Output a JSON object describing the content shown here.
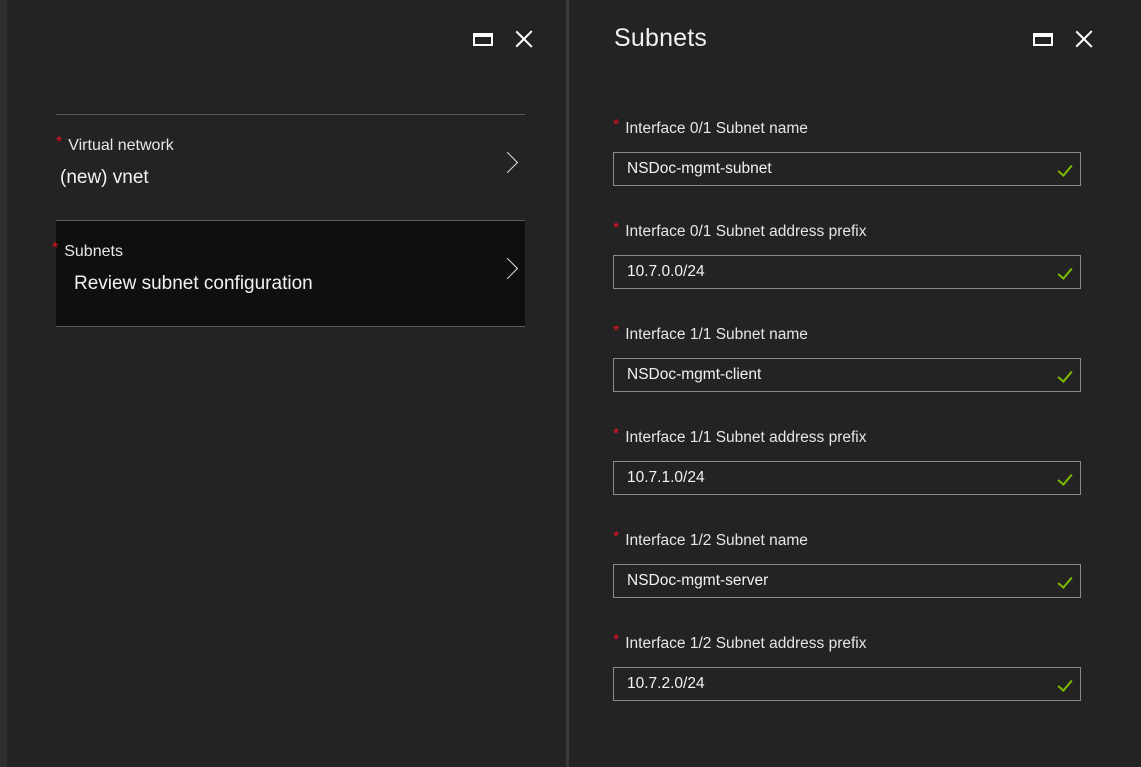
{
  "left_blade": {
    "menu_items": [
      {
        "label": "Virtual network",
        "value": "(new) vnet",
        "required": "*",
        "selected": false
      },
      {
        "label": "Subnets",
        "value": "Review subnet configuration",
        "required": "*",
        "selected": true
      }
    ]
  },
  "right_blade": {
    "title": "Subnets",
    "fields": [
      {
        "label": "Interface 0/1 Subnet name",
        "value": "NSDoc-mgmt-subnet",
        "required": "*"
      },
      {
        "label": "Interface 0/1 Subnet address prefix",
        "value": "10.7.0.0/24",
        "required": "*"
      },
      {
        "label": "Interface 1/1 Subnet name",
        "value": "NSDoc-mgmt-client",
        "required": "*"
      },
      {
        "label": "Interface 1/1 Subnet address prefix",
        "value": "10.7.1.0/24",
        "required": "*"
      },
      {
        "label": "Interface 1/2 Subnet name",
        "value": "NSDoc-mgmt-server",
        "required": "*"
      },
      {
        "label": "Interface 1/2 Subnet address prefix",
        "value": "10.7.2.0/24",
        "required": "*"
      }
    ]
  },
  "icons": {
    "maximize": "maximize-icon",
    "close": "close-icon",
    "chevron": "chevron-right-icon",
    "valid": "checkmark-icon"
  },
  "colors": {
    "background": "#232323",
    "required_star": "#e81123",
    "valid_check": "#7fba00",
    "selected_item": "#0f0f0f"
  }
}
